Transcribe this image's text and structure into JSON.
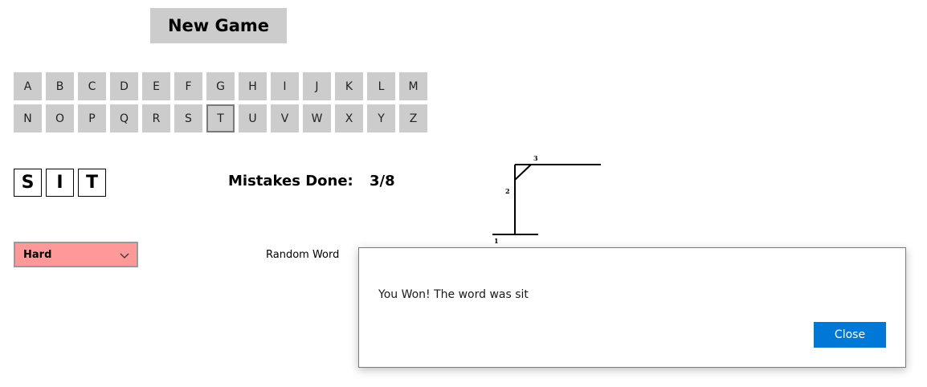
{
  "toolbar": {
    "new_game_label": "New Game"
  },
  "alphabet": {
    "letters": [
      "A",
      "B",
      "C",
      "D",
      "E",
      "F",
      "G",
      "H",
      "I",
      "J",
      "K",
      "L",
      "M",
      "N",
      "O",
      "P",
      "Q",
      "R",
      "S",
      "T",
      "U",
      "V",
      "W",
      "X",
      "Y",
      "Z"
    ],
    "selected": "T"
  },
  "word": {
    "letters": [
      "S",
      "I",
      "T"
    ]
  },
  "mistakes": {
    "label": "Mistakes Done:",
    "value": "3/8"
  },
  "gallows": {
    "step_labels": [
      "1",
      "2",
      "3"
    ]
  },
  "difficulty": {
    "selected": "Hard",
    "color": "#ff9999"
  },
  "random_word": {
    "label": "Random Word"
  },
  "dialog": {
    "message": "You Won! The word was sit",
    "close_label": "Close",
    "accent": "#0078d7"
  }
}
